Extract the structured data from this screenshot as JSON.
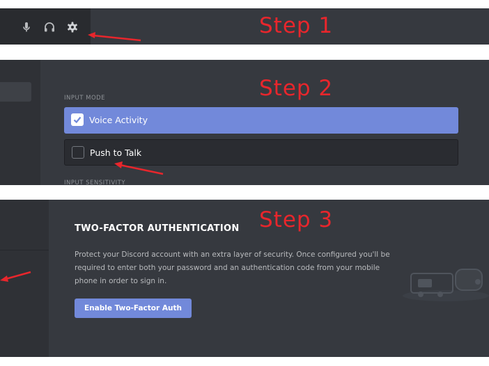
{
  "steps": {
    "one": "Step 1",
    "two": "Step 2",
    "three": "Step 3"
  },
  "panel1": {
    "icons": [
      "microphone-icon",
      "headphones-icon",
      "gear-icon"
    ]
  },
  "panel2": {
    "input_mode_header": "INPUT MODE",
    "options": [
      {
        "label": "Voice Activity",
        "checked": true
      },
      {
        "label": "Push to Talk",
        "checked": false
      }
    ],
    "input_sensitivity_header": "INPUT SENSITIVITY"
  },
  "panel3": {
    "title": "TWO-FACTOR AUTHENTICATION",
    "description": "Protect your Discord account with an extra layer of security. Once configured you'll be required to enter both your password and an authentication code from your mobile phone in order to sign in.",
    "button_label": "Enable Two-Factor Auth"
  },
  "colors": {
    "accent": "#7289da",
    "annotation": "#e8262c",
    "panel_bg": "#36393f"
  }
}
